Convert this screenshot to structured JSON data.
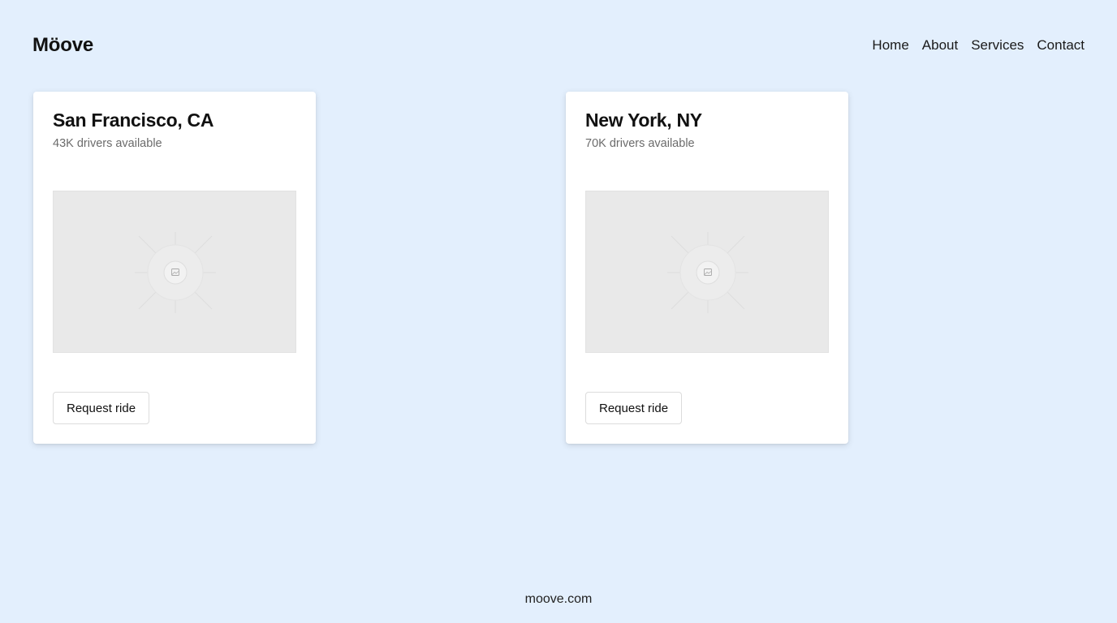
{
  "brand": {
    "name": "Möove"
  },
  "nav": {
    "items": [
      {
        "label": "Home"
      },
      {
        "label": "About"
      },
      {
        "label": "Services"
      },
      {
        "label": "Contact"
      }
    ]
  },
  "cards": [
    {
      "city": "San Francisco, CA",
      "drivers": "43K drivers available",
      "image_icon": "image-placeholder-icon",
      "button_label": "Request ride"
    },
    {
      "city": "New York, NY",
      "drivers": "70K drivers available",
      "image_icon": "image-placeholder-icon",
      "button_label": "Request ride"
    }
  ],
  "footer": {
    "text": "moove.com"
  },
  "colors": {
    "background": "#e3effd",
    "card": "#ffffff",
    "placeholder": "#e9e9e9"
  }
}
